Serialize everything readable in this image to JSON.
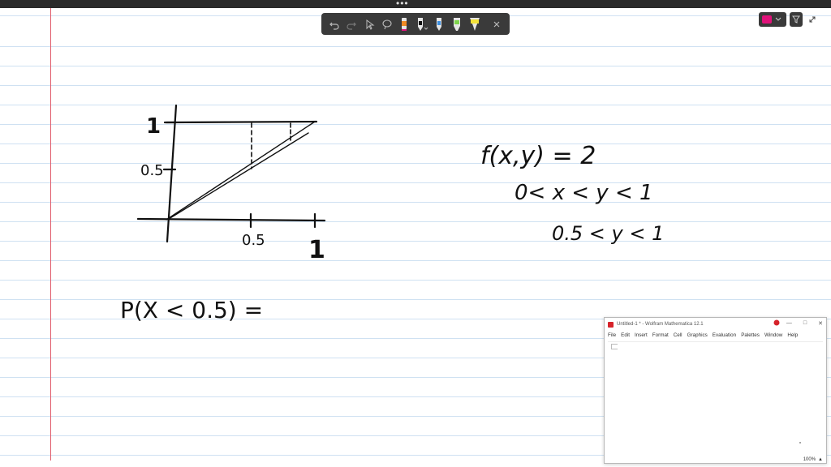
{
  "app": {
    "window_dots": "•••"
  },
  "toolbar": {
    "tools": [
      {
        "name": "undo-icon"
      },
      {
        "name": "redo-icon"
      },
      {
        "name": "select-icon"
      },
      {
        "name": "lasso-icon"
      },
      {
        "name": "pen-orange-icon"
      },
      {
        "name": "pen-black-icon"
      },
      {
        "name": "pen-blue-icon"
      },
      {
        "name": "highlighter-green-icon"
      },
      {
        "name": "highlighter-yellow-icon"
      },
      {
        "name": "close-icon"
      }
    ]
  },
  "colors": {
    "accent_pen": "#e0127a",
    "ink": "#111111",
    "margin": "#e05b6a",
    "rule": "#cfe1f2"
  },
  "notes": {
    "axis_y_top": "1",
    "axis_y_half": "0.5",
    "axis_x_half": "0.5",
    "axis_x_one": "1",
    "eq1": "f(x,y) = 2",
    "eq2": "0< x < y < 1",
    "eq3": "0.5 < y < 1",
    "eq4": "P(X < 0.5) ="
  },
  "mathematica": {
    "title": "Untitled-1 * - Wolfram Mathematica 12.1",
    "minimize": "—",
    "maximize": "□",
    "close": "✕",
    "menu": [
      "File",
      "Edit",
      "Insert",
      "Format",
      "Cell",
      "Graphics",
      "Evaluation",
      "Palettes",
      "Window",
      "Help"
    ],
    "zoom": "100%"
  }
}
